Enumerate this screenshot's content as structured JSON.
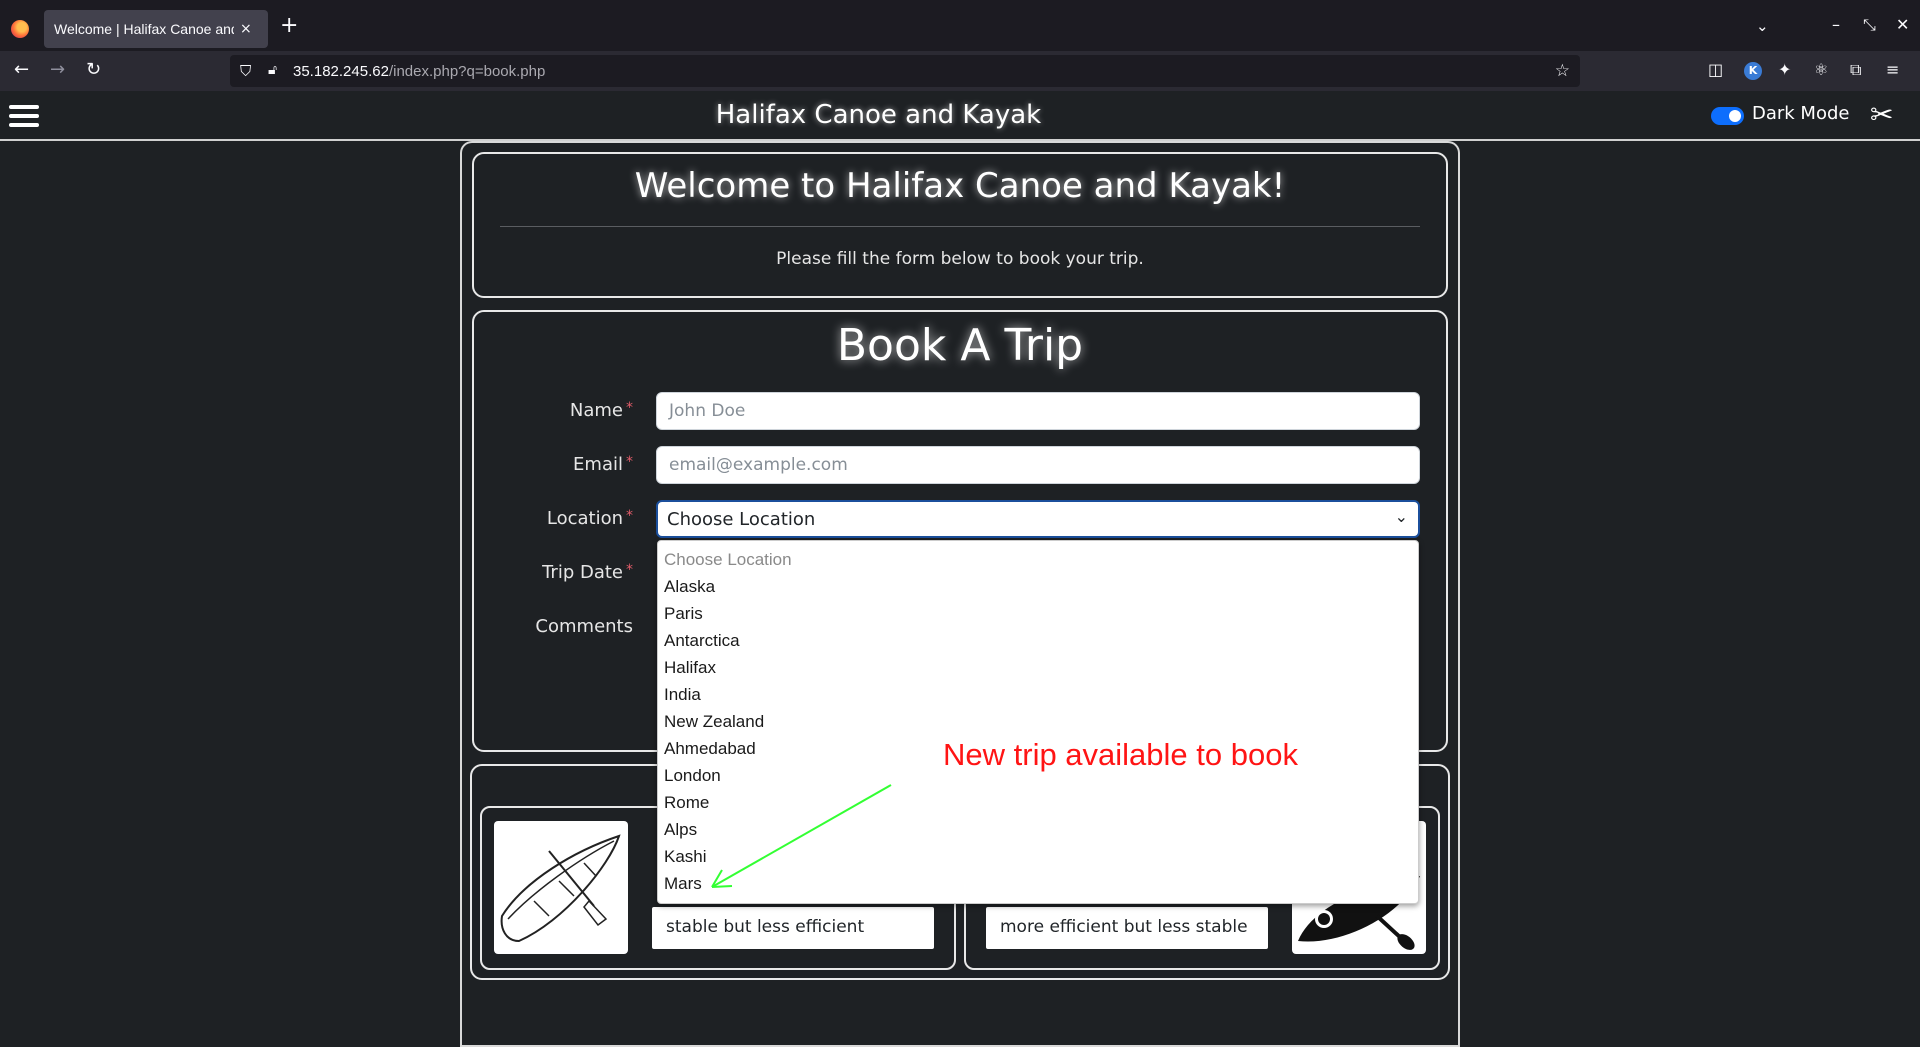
{
  "browser": {
    "tab_title": "Welcome | Halifax Canoe and Kayak",
    "tab_close": "×",
    "new_tab": "+",
    "url_host": "35.182.245.62",
    "url_path": "/index.php?q=book.php",
    "ext_k": "K"
  },
  "header": {
    "site_title": "Halifax Canoe and Kayak",
    "dark_mode_label": "Dark Mode"
  },
  "welcome": {
    "title": "Welcome to Halifax Canoe and Kayak!",
    "subtitle": "Please fill the form below to book your trip."
  },
  "form": {
    "title": "Book A Trip",
    "required_mark": "*",
    "name_label": "Name",
    "name_placeholder": "John Doe",
    "email_label": "Email",
    "email_placeholder": "email@example.com",
    "location_label": "Location",
    "location_selected": "Choose Location",
    "trip_date_label": "Trip Date",
    "comments_label": "Comments",
    "location_options": [
      "Choose Location",
      "Alaska",
      "Paris",
      "Antarctica",
      "Halifax",
      "India",
      "New Zealand",
      "Ahmedabad",
      "London",
      "Rome",
      "Alps",
      "Kashi",
      "Mars"
    ]
  },
  "annotation": {
    "text": "New trip available to book",
    "color": "#ff1414",
    "arrow_color": "#33ff33"
  },
  "boats": {
    "canoe_desc": "stable but less efficient",
    "kayak_desc": "more efficient but less stable"
  },
  "colors": {
    "page_bg": "#1e2124",
    "accent": "#0d6efd",
    "required": "#e35d6a"
  }
}
